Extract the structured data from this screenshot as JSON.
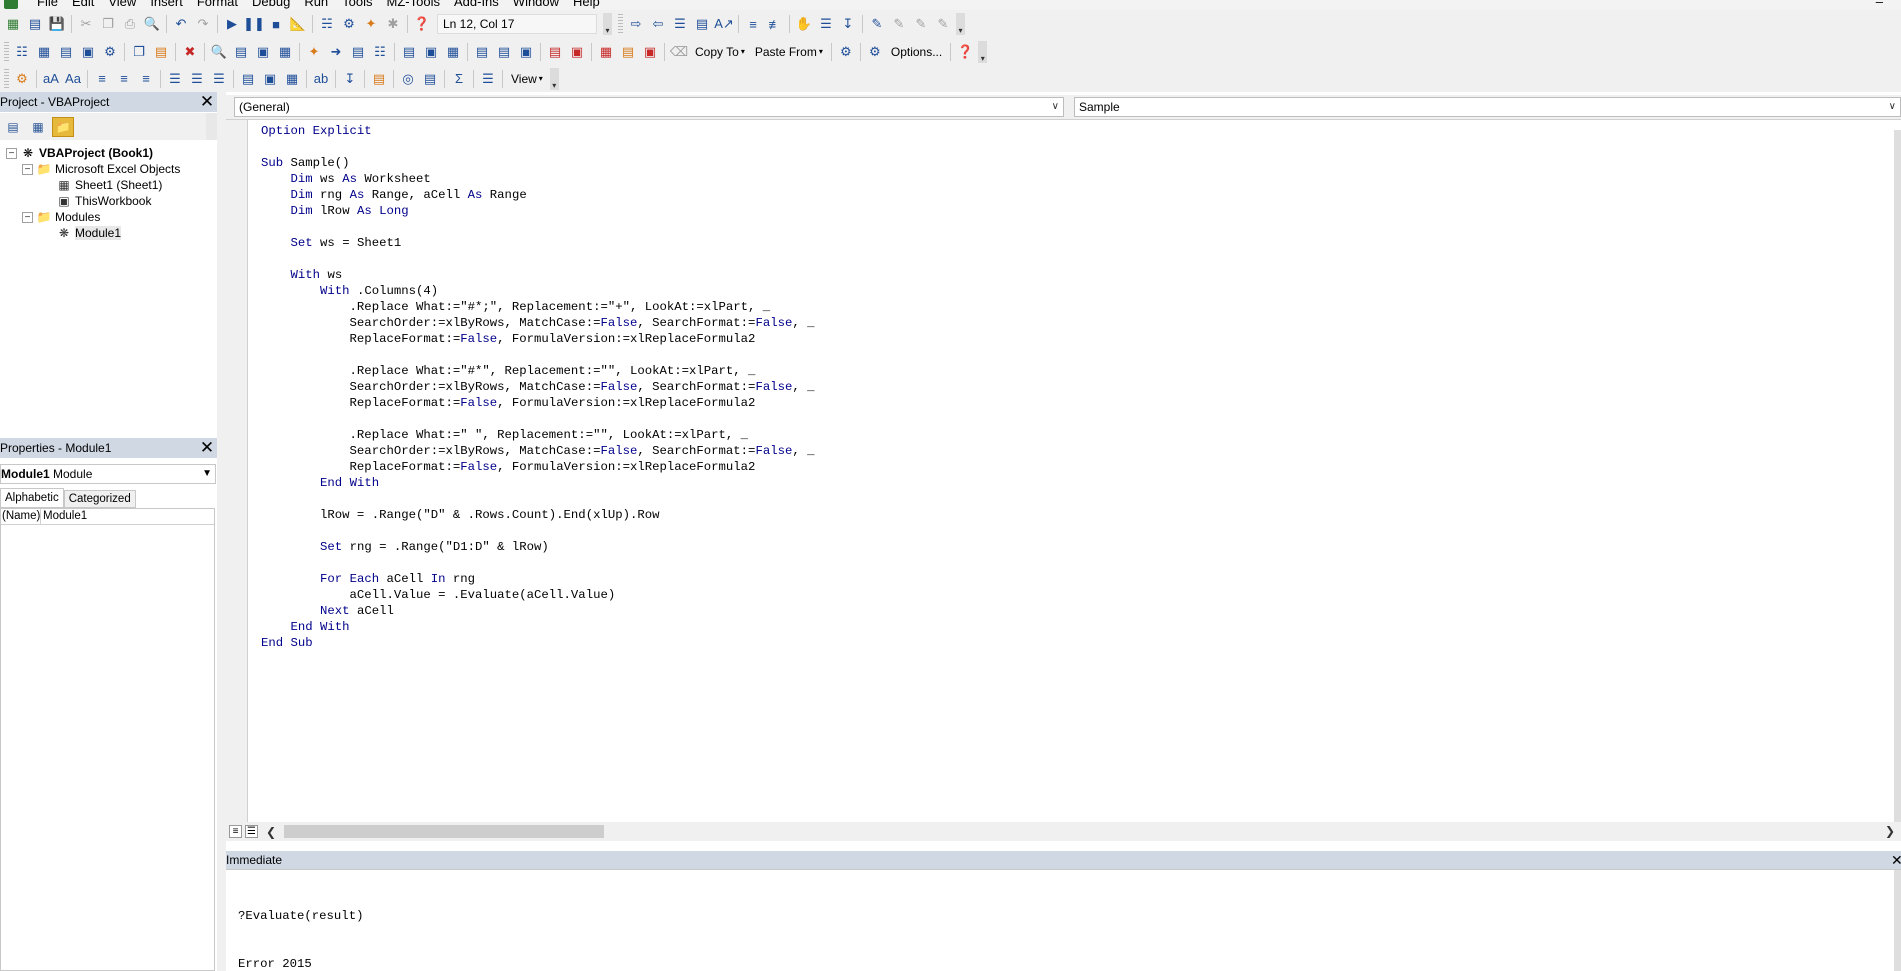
{
  "menubar": {
    "items": [
      "File",
      "Edit",
      "View",
      "Insert",
      "Format",
      "Debug",
      "Run",
      "Tools",
      "MZ-Tools",
      "Add-Ins",
      "Window",
      "Help"
    ],
    "window_control": "–"
  },
  "toolbar": {
    "position_text": "Ln 12, Col 17",
    "copy_to_label": "Copy To",
    "paste_from_label": "Paste From",
    "options_label": "Options...",
    "view_label": "View"
  },
  "project_panel": {
    "title": "Project - VBAProject",
    "tree": {
      "root": "VBAProject (Book1)",
      "excel_objects_folder": "Microsoft Excel Objects",
      "sheet1": "Sheet1 (Sheet1)",
      "this_workbook": "ThisWorkbook",
      "modules_folder": "Modules",
      "module1": "Module1"
    }
  },
  "properties_panel": {
    "title": "Properties - Module1",
    "object_name": "Module1",
    "object_type": "Module",
    "tabs": [
      "Alphabetic",
      "Categorized"
    ],
    "rows": [
      {
        "name": "(Name)",
        "value": "Module1"
      }
    ]
  },
  "code_window": {
    "object_combo": "(General)",
    "procedure_combo": "Sample",
    "lines": [
      [
        {
          "k": true,
          "t": "Option Explicit"
        }
      ],
      [
        {
          "k": false,
          "t": ""
        }
      ],
      [
        {
          "k": true,
          "t": "Sub"
        },
        {
          "k": false,
          "t": " Sample()"
        }
      ],
      [
        {
          "k": false,
          "t": "    "
        },
        {
          "k": true,
          "t": "Dim"
        },
        {
          "k": false,
          "t": " ws "
        },
        {
          "k": true,
          "t": "As"
        },
        {
          "k": false,
          "t": " Worksheet"
        }
      ],
      [
        {
          "k": false,
          "t": "    "
        },
        {
          "k": true,
          "t": "Dim"
        },
        {
          "k": false,
          "t": " rng "
        },
        {
          "k": true,
          "t": "As"
        },
        {
          "k": false,
          "t": " Range, aCell "
        },
        {
          "k": true,
          "t": "As"
        },
        {
          "k": false,
          "t": " Range"
        }
      ],
      [
        {
          "k": false,
          "t": "    "
        },
        {
          "k": true,
          "t": "Dim"
        },
        {
          "k": false,
          "t": " lRow "
        },
        {
          "k": true,
          "t": "As Long"
        }
      ],
      [
        {
          "k": false,
          "t": ""
        }
      ],
      [
        {
          "k": false,
          "t": "    "
        },
        {
          "k": true,
          "t": "Set"
        },
        {
          "k": false,
          "t": " ws = Sheet1"
        }
      ],
      [
        {
          "k": false,
          "t": ""
        }
      ],
      [
        {
          "k": false,
          "t": "    "
        },
        {
          "k": true,
          "t": "With"
        },
        {
          "k": false,
          "t": " ws"
        }
      ],
      [
        {
          "k": false,
          "t": "        "
        },
        {
          "k": true,
          "t": "With"
        },
        {
          "k": false,
          "t": " .Columns(4)"
        }
      ],
      [
        {
          "k": false,
          "t": "            .Replace What:=\"#*;\", Replacement:=\"+\", LookAt:=xlPart, _"
        }
      ],
      [
        {
          "k": false,
          "t": "            SearchOrder:=xlByRows, MatchCase:="
        },
        {
          "k": true,
          "t": "False"
        },
        {
          "k": false,
          "t": ", SearchFormat:="
        },
        {
          "k": true,
          "t": "False"
        },
        {
          "k": false,
          "t": ", _"
        }
      ],
      [
        {
          "k": false,
          "t": "            ReplaceFormat:="
        },
        {
          "k": true,
          "t": "False"
        },
        {
          "k": false,
          "t": ", FormulaVersion:=xlReplaceFormula2"
        }
      ],
      [
        {
          "k": false,
          "t": ""
        }
      ],
      [
        {
          "k": false,
          "t": "            .Replace What:=\"#*\", Replacement:=\"\", LookAt:=xlPart, _"
        }
      ],
      [
        {
          "k": false,
          "t": "            SearchOrder:=xlByRows, MatchCase:="
        },
        {
          "k": true,
          "t": "False"
        },
        {
          "k": false,
          "t": ", SearchFormat:="
        },
        {
          "k": true,
          "t": "False"
        },
        {
          "k": false,
          "t": ", _"
        }
      ],
      [
        {
          "k": false,
          "t": "            ReplaceFormat:="
        },
        {
          "k": true,
          "t": "False"
        },
        {
          "k": false,
          "t": ", FormulaVersion:=xlReplaceFormula2"
        }
      ],
      [
        {
          "k": false,
          "t": ""
        }
      ],
      [
        {
          "k": false,
          "t": "            .Replace What:=\" \", Replacement:=\"\", LookAt:=xlPart, _"
        }
      ],
      [
        {
          "k": false,
          "t": "            SearchOrder:=xlByRows, MatchCase:="
        },
        {
          "k": true,
          "t": "False"
        },
        {
          "k": false,
          "t": ", SearchFormat:="
        },
        {
          "k": true,
          "t": "False"
        },
        {
          "k": false,
          "t": ", _"
        }
      ],
      [
        {
          "k": false,
          "t": "            ReplaceFormat:="
        },
        {
          "k": true,
          "t": "False"
        },
        {
          "k": false,
          "t": ", FormulaVersion:=xlReplaceFormula2"
        }
      ],
      [
        {
          "k": false,
          "t": "        "
        },
        {
          "k": true,
          "t": "End With"
        }
      ],
      [
        {
          "k": false,
          "t": ""
        }
      ],
      [
        {
          "k": false,
          "t": "        lRow = .Range(\"D\" & .Rows.Count).End(xlUp).Row"
        }
      ],
      [
        {
          "k": false,
          "t": ""
        }
      ],
      [
        {
          "k": false,
          "t": "        "
        },
        {
          "k": true,
          "t": "Set"
        },
        {
          "k": false,
          "t": " rng = .Range(\"D1:D\" & lRow)"
        }
      ],
      [
        {
          "k": false,
          "t": ""
        }
      ],
      [
        {
          "k": false,
          "t": "        "
        },
        {
          "k": true,
          "t": "For Each"
        },
        {
          "k": false,
          "t": " aCell "
        },
        {
          "k": true,
          "t": "In"
        },
        {
          "k": false,
          "t": " rng"
        }
      ],
      [
        {
          "k": false,
          "t": "            aCell.Value = .Evaluate(aCell.Value)"
        }
      ],
      [
        {
          "k": false,
          "t": "        "
        },
        {
          "k": true,
          "t": "Next"
        },
        {
          "k": false,
          "t": " aCell"
        }
      ],
      [
        {
          "k": false,
          "t": "    "
        },
        {
          "k": true,
          "t": "End With"
        }
      ],
      [
        {
          "k": true,
          "t": "End Sub"
        }
      ]
    ]
  },
  "immediate": {
    "title": "Immediate",
    "lines": [
      "?Evaluate(result)",
      "Error 2015"
    ]
  },
  "colors": {
    "keyword": "#00008b",
    "panel_title_bg": "#cfd8e3",
    "toolbar_bg": "#f0f0f0"
  }
}
